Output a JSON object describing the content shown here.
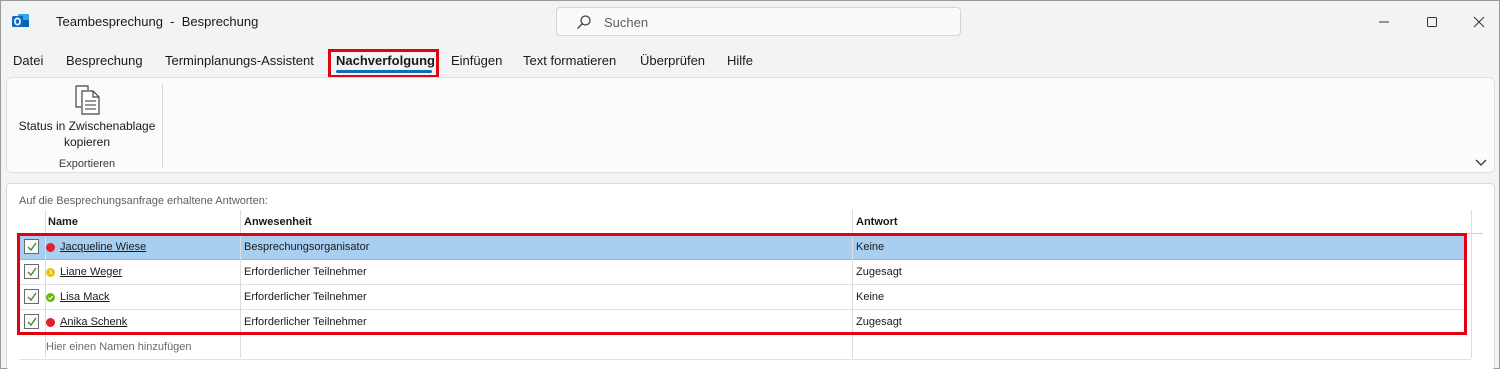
{
  "app": {
    "icon": "outlook-icon",
    "title": "Teambesprechung  -  Besprechung"
  },
  "search": {
    "placeholder": "Suchen"
  },
  "window_controls": [
    "minimize-icon",
    "maximize-icon",
    "close-icon"
  ],
  "tabs": [
    {
      "label": "Datei"
    },
    {
      "label": "Besprechung"
    },
    {
      "label": "Terminplanungs-Assistent"
    },
    {
      "label": "Nachverfolgung",
      "active": true
    },
    {
      "label": "Einfügen"
    },
    {
      "label": "Text formatieren"
    },
    {
      "label": "Überprüfen"
    },
    {
      "label": "Hilfe"
    }
  ],
  "ribbon": {
    "button": {
      "line1": "Status in Zwischenablage",
      "line2": "kopieren",
      "icon": "copy-document-icon"
    },
    "group_label": "Exportieren"
  },
  "panel": {
    "caption": "Auf die Besprechungsanfrage erhaltene Antworten:",
    "columns": {
      "name": "Name",
      "attendance": "Anwesenheit",
      "response": "Antwort"
    },
    "rows": [
      {
        "checked": true,
        "status_color": "#e0202a",
        "status": "busy",
        "name": "Jacqueline Wiese",
        "attendance": "Besprechungsorganisator",
        "response": "Keine",
        "selected": true
      },
      {
        "checked": true,
        "status_color": "#f2c200",
        "status": "away",
        "name": "Liane Weger",
        "attendance": "Erforderlicher Teilnehmer",
        "response": "Zugesagt"
      },
      {
        "checked": true,
        "status_color": "#6bb700",
        "status": "available",
        "name": "Lisa Mack",
        "attendance": "Erforderlicher Teilnehmer",
        "response": "Keine"
      },
      {
        "checked": true,
        "status_color": "#e0202a",
        "status": "busy",
        "name": "Anika Schenk",
        "attendance": "Erforderlicher Teilnehmer",
        "response": "Zugesagt"
      }
    ],
    "add_placeholder": "Hier einen Namen hinzufügen"
  },
  "colors": {
    "accent": "#0f6cbd",
    "highlight_frame": "#e3000f",
    "selected_row": "#a9cff0"
  }
}
